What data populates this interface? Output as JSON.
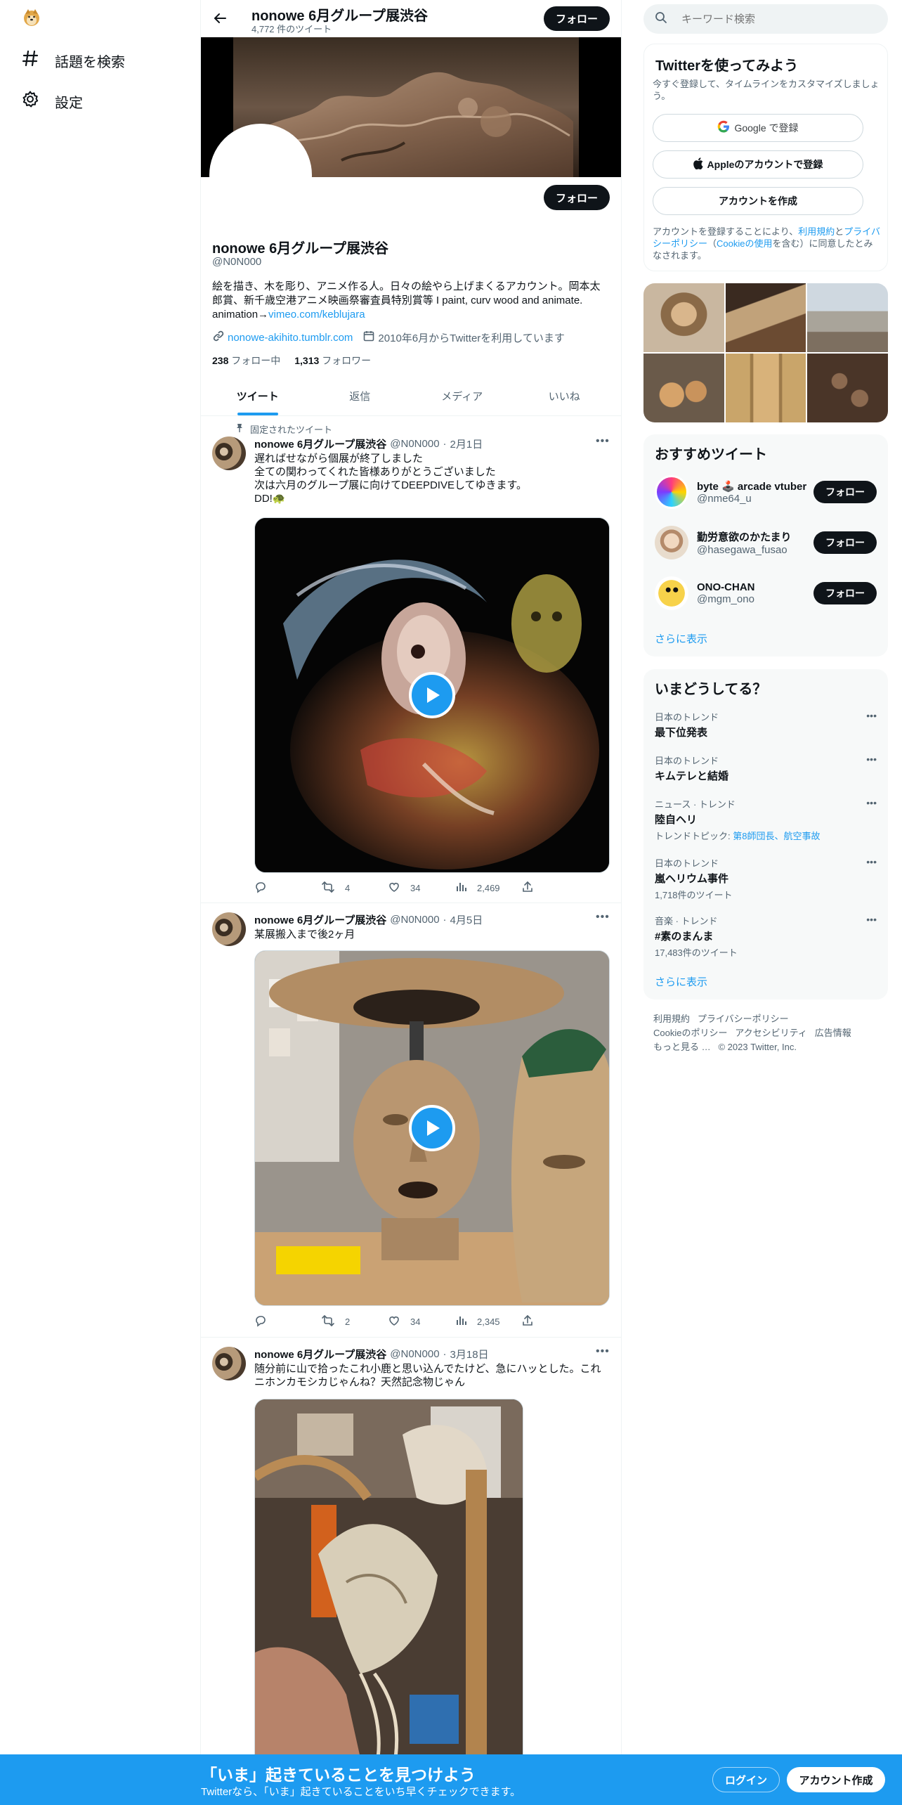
{
  "sidebar": {
    "logo": "doge-logo",
    "items": [
      {
        "icon": "hash-icon",
        "label": "話題を検索"
      },
      {
        "icon": "gear-icon",
        "label": "設定"
      }
    ]
  },
  "header": {
    "title": "nonowe 6月グループ展渋谷",
    "tweet_count": "4,772 件のツイート",
    "follow_label": "フォロー"
  },
  "profile": {
    "follow_label": "フォロー",
    "name": "nonowe 6月グループ展渋谷",
    "handle": "@N0N000",
    "bio_line1": "絵を描き、木を彫り、アニメ作る人。日々の絵やら上げまくるアカウント。岡本太",
    "bio_line2": "郎賞、新千歳空港アニメ映画祭審査員特別賞等 I paint, curv wood and animate.",
    "bio_line3_prefix": "animation→",
    "bio_link": "vimeo.com/keblujara",
    "website": "nonowe-akihito.tumblr.com",
    "joined": "2010年6月からTwitterを利用しています",
    "following_count": "238",
    "following_label": "フォロー中",
    "followers_count": "1,313",
    "followers_label": "フォロワー"
  },
  "tabs": [
    {
      "label": "ツイート",
      "active": true
    },
    {
      "label": "返信",
      "active": false
    },
    {
      "label": "メディア",
      "active": false
    },
    {
      "label": "いいね",
      "active": false
    }
  ],
  "tweets": [
    {
      "pinned_label": "固定されたツイート",
      "name": "nonowe 6月グループ展渋谷",
      "handle": "@N0N000",
      "sep": "·",
      "date": "2月1日",
      "text": "遅ればせながら個展が終了しました\n全ての関わってくれた皆様ありがとうございました\n次は六月のグループ展に向けてDEEPDIVEしてゆきます。\nDD!🐢",
      "media": "video",
      "retweets": "4",
      "likes": "34",
      "views": "2,469"
    },
    {
      "name": "nonowe 6月グループ展渋谷",
      "handle": "@N0N000",
      "sep": "·",
      "date": "4月5日",
      "text": "某展搬入まで後2ヶ月",
      "media": "video",
      "retweets": "2",
      "likes": "34",
      "views": "2,345"
    },
    {
      "name": "nonowe 6月グループ展渋谷",
      "handle": "@N0N000",
      "sep": "·",
      "date": "3月18日",
      "text": "随分前に山で拾ったこれ小鹿と思い込んでたけど、急にハッとした。これ\nニホンカモシカじゃんね？天然記念物じゃん",
      "media": "photo"
    }
  ],
  "search": {
    "placeholder": "キーワード検索"
  },
  "signup": {
    "title": "Twitterを使ってみよう",
    "subtitle": "今すぐ登録して、タイムラインをカスタマイズしましょう。",
    "google_label": "Google で登録",
    "apple_label": "Appleのアカウントで登録",
    "create_label": "アカウントを作成",
    "terms_1": "アカウントを登録することにより、",
    "terms_link1": "利用規約",
    "terms_2": "と",
    "terms_link2": "プライバシーポリシー",
    "terms_3": "（",
    "terms_link3": "Cookieの使用",
    "terms_4": "を含む）に同意したとみなされます。"
  },
  "recommended": {
    "title": "おすすめツイート",
    "users": [
      {
        "name": "byte 🕹️ arcade vtuber",
        "handle": "@nme64_u",
        "follow_label": "フォロー"
      },
      {
        "name": "勤労意欲のかたまり",
        "handle": "@hasegawa_fusao",
        "follow_label": "フォロー"
      },
      {
        "name": "ONO-CHAN",
        "handle": "@mgm_ono",
        "follow_label": "フォロー"
      }
    ],
    "show_more": "さらに表示"
  },
  "trends": {
    "title": "いまどうしてる？",
    "items": [
      {
        "context": "日本のトレンド",
        "name": "最下位発表"
      },
      {
        "context": "日本のトレンド",
        "name": "キムテレと結婚"
      },
      {
        "context": "ニュース · トレンド",
        "name": "陸自ヘリ",
        "topics_label": "トレンドトピック: ",
        "topics": "第8師団長、航空事故"
      },
      {
        "context": "日本のトレンド",
        "name": "嵐ヘリウム事件",
        "count": "1,718件のツイート"
      },
      {
        "context": "音楽 · トレンド",
        "name": "#素のまんま",
        "count": "17,483件のツイート"
      }
    ],
    "show_more": "さらに表示"
  },
  "footer": {
    "links": [
      "利用規約",
      "プライバシーポリシー",
      "Cookieのポリシー",
      "アクセシビリティ",
      "広告情報",
      "もっと見る …"
    ],
    "copyright": "© 2023 Twitter, Inc."
  },
  "bottom_bar": {
    "title": "「いま」起きていることを見つけよう",
    "subtitle": "Twitterなら、「いま」起きていることをいち早くチェックできます。",
    "login_label": "ログイン",
    "signup_label": "アカウント作成"
  }
}
